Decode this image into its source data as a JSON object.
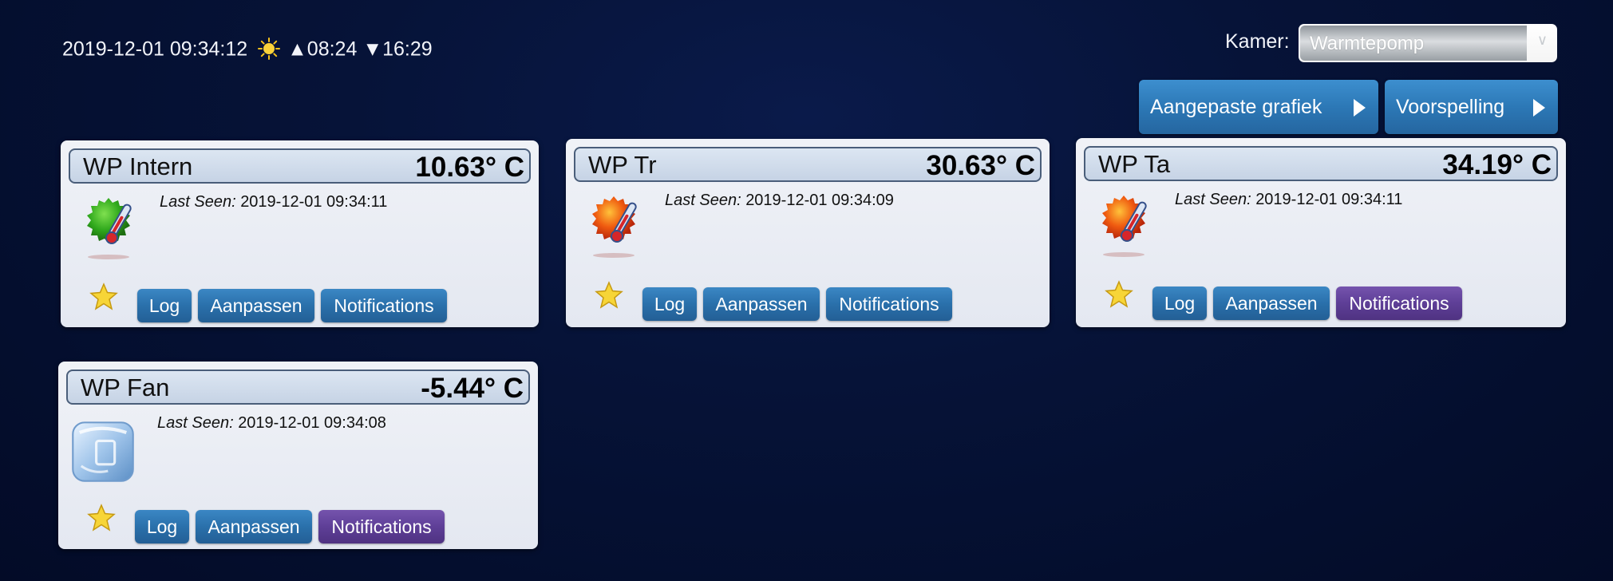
{
  "header": {
    "datetime": "2019-12-01 09:34:12",
    "sunrise": "▲08:24",
    "sunset": "▼16:29",
    "kamer_label": "Kamer:",
    "kamer_value": "Warmtepomp"
  },
  "top_buttons": {
    "grafiek": "Aangepaste grafiek",
    "voorspelling": "Voorspelling"
  },
  "cards": [
    {
      "name": "WP Intern",
      "temp": "10.63° C",
      "last_seen_label": "Last Seen:",
      "last_seen": "2019-12-01 09:34:11",
      "icon": "thermometer-green-icon",
      "btn_log": "Log",
      "btn_edit": "Aanpassen",
      "btn_notifications": "Notifications",
      "notifications_active": false
    },
    {
      "name": "WP Tr",
      "temp": "30.63° C",
      "last_seen_label": "Last Seen:",
      "last_seen": "2019-12-01 09:34:09",
      "icon": "thermometer-orange-icon",
      "btn_log": "Log",
      "btn_edit": "Aanpassen",
      "btn_notifications": "Notifications",
      "notifications_active": false
    },
    {
      "name": "WP Ta",
      "temp": "34.19° C",
      "last_seen_label": "Last Seen:",
      "last_seen": "2019-12-01 09:34:11",
      "icon": "thermometer-orange-icon",
      "btn_log": "Log",
      "btn_edit": "Aanpassen",
      "btn_notifications": "Notifications",
      "notifications_active": true
    },
    {
      "name": "WP Fan",
      "temp": "-5.44° C",
      "last_seen_label": "Last Seen:",
      "last_seen": "2019-12-01 09:34:08",
      "icon": "ice-cube-icon",
      "btn_log": "Log",
      "btn_edit": "Aanpassen",
      "btn_notifications": "Notifications",
      "notifications_active": true
    }
  ],
  "colors": {
    "background": "#061338",
    "button_blue": "#2c78b6",
    "button_purple": "#5e3f97",
    "card_bg": "#e9ecf3"
  }
}
